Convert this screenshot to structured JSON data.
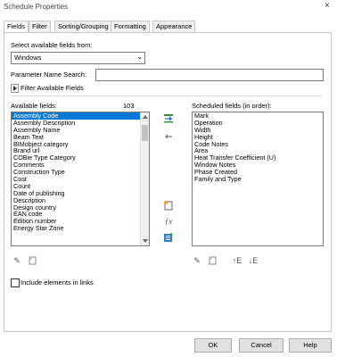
{
  "window": {
    "title": "Schedule Properties",
    "close_glyph": "×"
  },
  "tabs": [
    {
      "label": "Fields"
    },
    {
      "label": "Filter"
    },
    {
      "label": "Sorting/Grouping"
    },
    {
      "label": "Formatting"
    },
    {
      "label": "Appearance"
    }
  ],
  "fields_tab": {
    "select_from_label": "Select available fields from:",
    "category_value": "Windows",
    "param_search_label": "Parameter Name Search:",
    "param_search_value": "",
    "filter_available_label": "Filter Available Fields",
    "available_label": "Available fields:",
    "available_count": "103",
    "available_fields": [
      "Assembly Code",
      "Assembly Description",
      "Assembly Name",
      "Beam Text",
      "BIMobject category",
      "Brand url",
      "COBie Type Category",
      "Comments",
      "Construction Type",
      "Cost",
      "Count",
      "Date of publishing",
      "Description",
      "Design country",
      "EAN code",
      "Edition number",
      "Energy Star Zone"
    ],
    "selected_available_index": 0,
    "scheduled_label": "Scheduled fields (in order):",
    "scheduled_fields": [
      "Mark",
      "Operation",
      "Width",
      "Height",
      "Code Notes",
      "Area",
      "Heat Transfer Coefficient (U)",
      "Window Notes",
      "Phase Created",
      "Family and Type"
    ],
    "include_links_label": "Include elements in links",
    "include_links_checked": false
  },
  "buttons": {
    "ok": "OK",
    "cancel": "Cancel",
    "help": "Help"
  },
  "icons": {
    "add_field": "add-parameter-icon",
    "remove_field": "remove-parameter-icon",
    "new_parameter": "new-parameter-icon",
    "calculated_value": "fx-icon",
    "combine_parameters": "combine-parameters-icon",
    "edit": "pencil-icon",
    "delete": "delete-parameter-icon",
    "move_up": "move-up-icon",
    "move_down": "move-down-icon"
  },
  "colors": {
    "selection": "#0078d7",
    "border": "#7a7a7a",
    "tab_bg": "#f0f0f0"
  }
}
